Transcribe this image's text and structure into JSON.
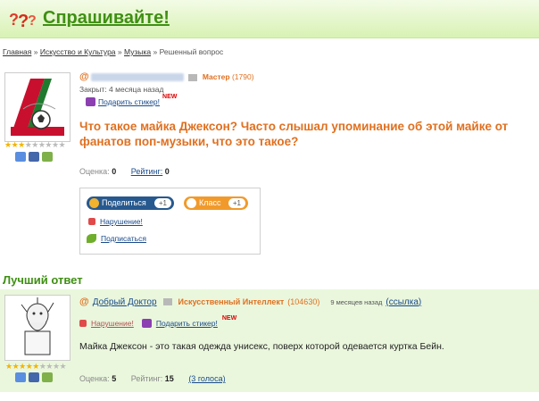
{
  "header": {
    "logo_text": "Спрашивайте!",
    "logo_icon": "question-marks-icon"
  },
  "breadcrumb": {
    "items": [
      "Главная",
      "Искусство и Культура",
      "Музыка",
      "Решенный вопрос"
    ],
    "separator": "»"
  },
  "question": {
    "author_rank": "Мастер",
    "author_points": "(1790)",
    "closed": "Закрыт: 4 месяца назад",
    "gift_label": "Подарить стикер!",
    "new_badge": "NEW",
    "title": "Что такое майка Джексон? Часто слышал упоминание об этой майке от фанатов поп-музыки, что это такое?",
    "rating_stars": 3,
    "score_label": "Оценка:",
    "score_value": "0",
    "rating_label": "Рейтинг:",
    "rating_value": "0"
  },
  "share": {
    "share_label": "Поделиться",
    "share_count": "+1",
    "class_label": "Класс",
    "class_count": "+1",
    "violation_label": "Нарушение!",
    "subscribe_label": "Подписаться"
  },
  "best_answer": {
    "section_title": "Лучший ответ",
    "author": "Добрый Доктор",
    "rank": "Искусственный Интеллект",
    "points": "(104630)",
    "date": "9 месяцев назад",
    "link_label": "(ссылка)",
    "violation_label": "Нарушение!",
    "gift_label": "Подарить стикер!",
    "new_badge": "NEW",
    "text": "Майка Джексон - это такая одежда унисекс, поверх которой одевается куртка Бейн.",
    "rating_stars": 5,
    "score_label": "Оценка:",
    "score_value": "5",
    "rating_label": "Рейтинг:",
    "rating_value": "15",
    "votes_label": "(3 голоса)"
  },
  "colors": {
    "accent_green": "#3f8f13",
    "orange": "#e07020",
    "link": "#1a4a8a"
  }
}
